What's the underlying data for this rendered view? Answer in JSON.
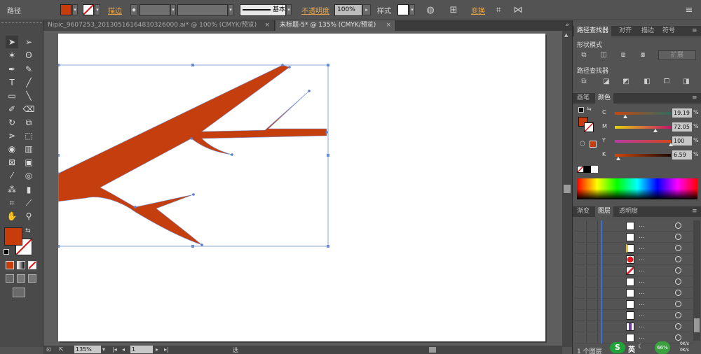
{
  "control_bar": {
    "path_label": "路径",
    "stroke_label": "描边",
    "stroke_profile": "基本",
    "opacity_label": "不透明度",
    "opacity_value": "100%",
    "style_label": "样式",
    "transform_label": "变换",
    "fill_color": "#c63c0a"
  },
  "tabs": [
    {
      "label": "Nipic_9607253_20130516164830326000.ai* @ 100% (CMYK/预览)",
      "close": "×"
    },
    {
      "label": "未标题-5* @ 135% (CMYK/预览)",
      "close": "×"
    }
  ],
  "panels": {
    "pathfinder": {
      "tabs": [
        "路径查找器",
        "对齐",
        "描边",
        "符号"
      ],
      "shape_modes_label": "形状模式",
      "expand_label": "扩展",
      "pathfinders_label": "路径查找器"
    },
    "color": {
      "tabs": [
        "画笔",
        "颜色"
      ],
      "channels": [
        {
          "letter": "C",
          "value": "19.19",
          "pct": "%",
          "level": 0.19
        },
        {
          "letter": "M",
          "value": "72.05",
          "pct": "%",
          "level": 0.72
        },
        {
          "letter": "Y",
          "value": "100",
          "pct": "%",
          "level": 1.0
        },
        {
          "letter": "K",
          "value": "6.59",
          "pct": "%",
          "level": 0.066
        }
      ]
    },
    "layers": {
      "tabs": [
        "渐变",
        "图层",
        "透明度"
      ],
      "rows": [
        {
          "name": "...",
          "thumb": "white"
        },
        {
          "name": "...",
          "thumb": "white"
        },
        {
          "name": "...",
          "thumb": "yellow-curve"
        },
        {
          "name": "...",
          "thumb": "red-apple"
        },
        {
          "name": "...",
          "thumb": "red-leaf"
        },
        {
          "name": "...",
          "thumb": "white"
        },
        {
          "name": "...",
          "thumb": "white"
        },
        {
          "name": "...",
          "thumb": "white"
        },
        {
          "name": "...",
          "thumb": "white"
        },
        {
          "name": "...",
          "thumb": "purple"
        },
        {
          "name": "...",
          "thumb": "white"
        }
      ],
      "footer": "1 个图层"
    }
  },
  "status": {
    "zoom": "135%",
    "page": "1",
    "tool": "选择"
  },
  "ime": {
    "lang": "英",
    "battery": "66%",
    "net_up": "0K/s",
    "net_down": "0K/s"
  }
}
